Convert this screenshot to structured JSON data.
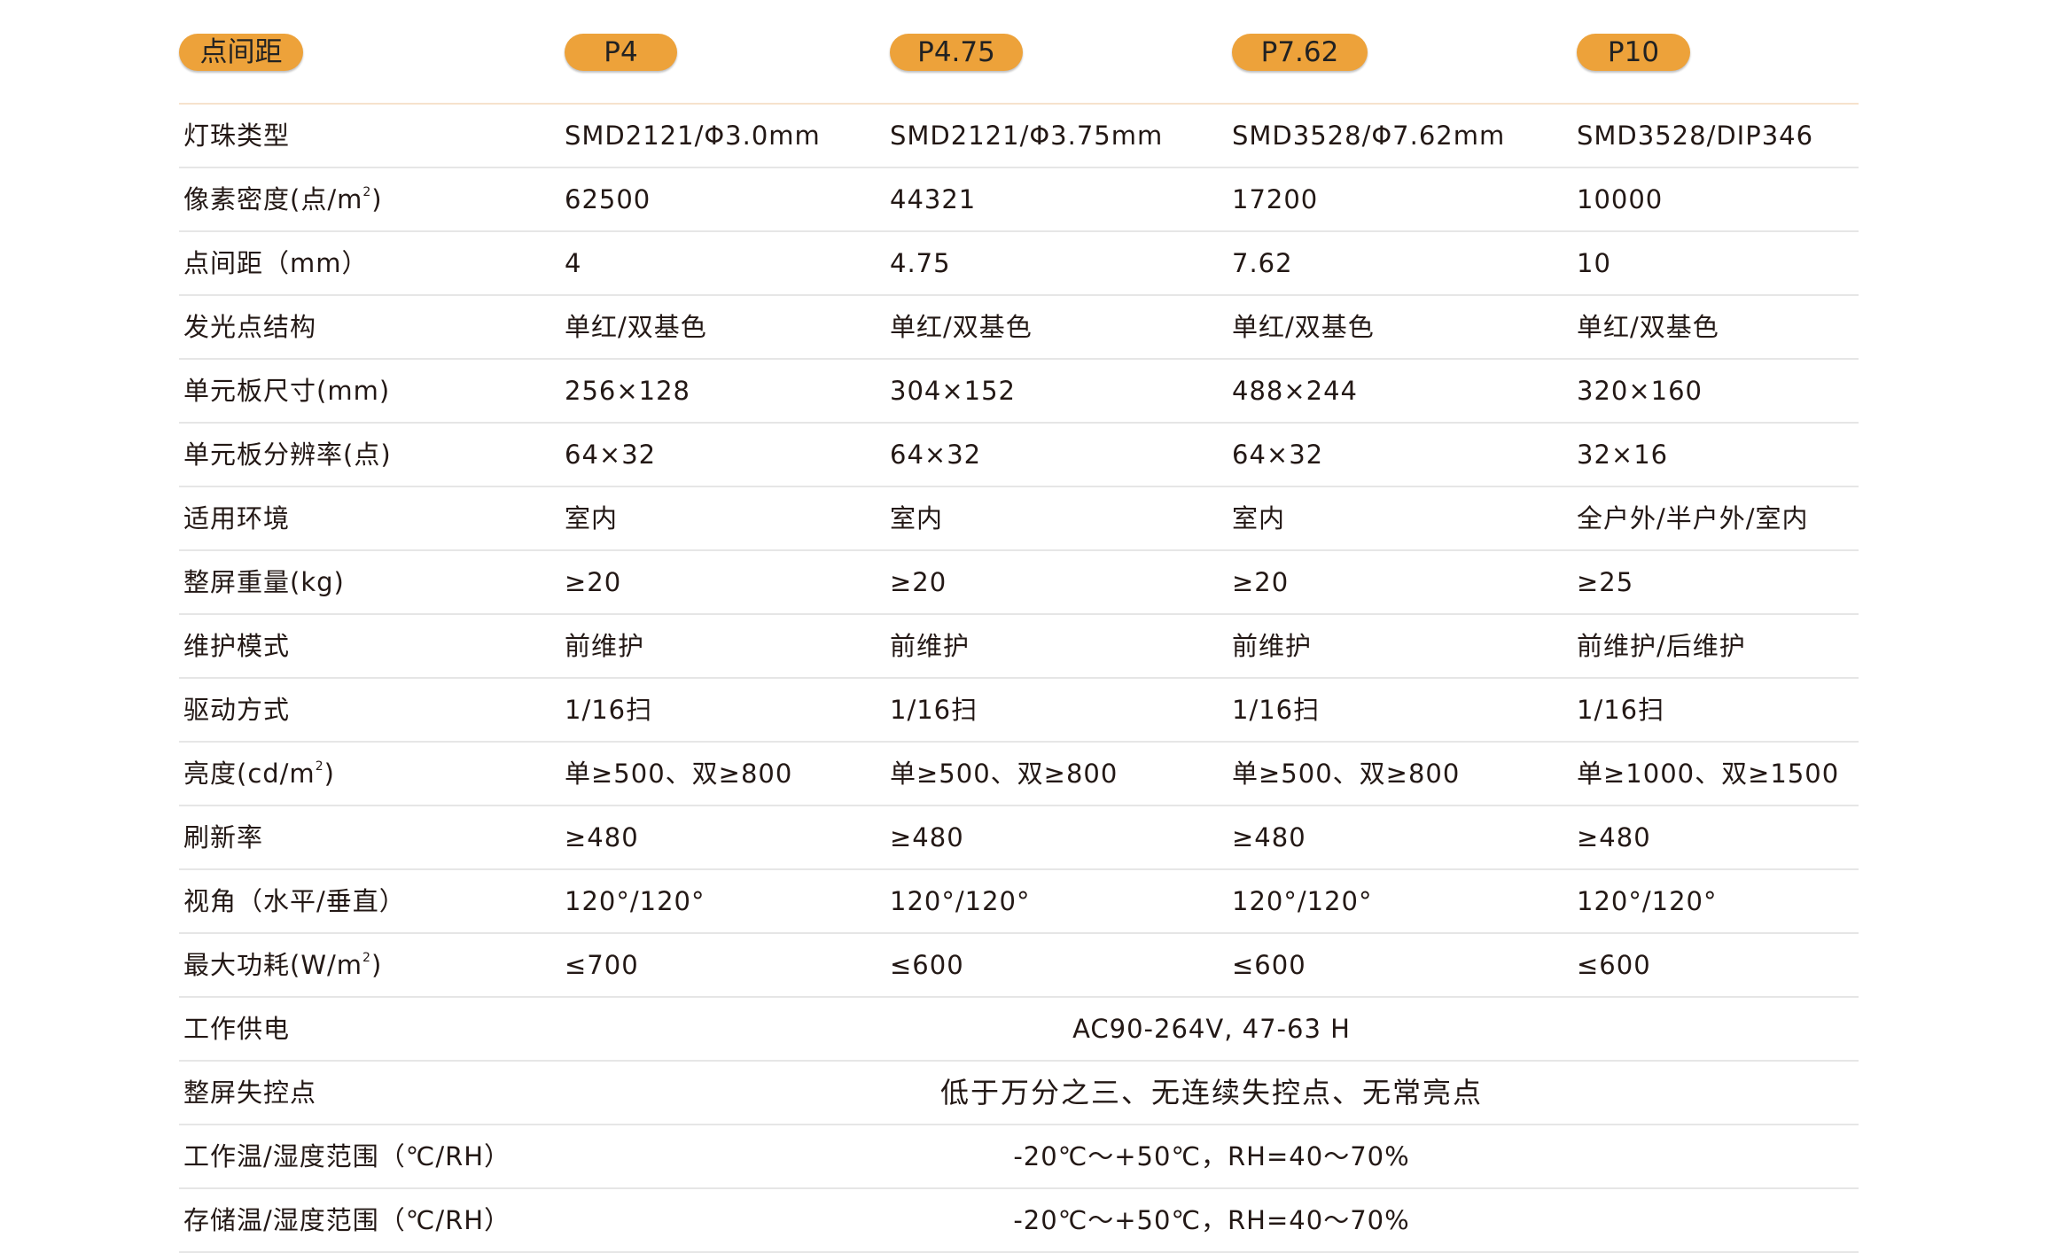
{
  "header": {
    "label": "点间距",
    "columns": [
      "P4",
      "P4.75",
      "P7.62",
      "P10"
    ]
  },
  "rows": [
    {
      "label": "灯珠类型",
      "values": [
        "SMD2121/Φ3.0mm",
        "SMD2121/Φ3.75mm",
        "SMD3528/Φ7.62mm",
        "SMD3528/DIP346"
      ]
    },
    {
      "label_pre": "像素密度(点/m",
      "label_sup": "2",
      "label_post": ")",
      "values": [
        "62500",
        "44321",
        "17200",
        "10000"
      ]
    },
    {
      "label": "点间距（mm）",
      "values": [
        "4",
        "4.75",
        "7.62",
        "10"
      ]
    },
    {
      "label": "发光点结构",
      "values": [
        "单红/双基色",
        "单红/双基色",
        "单红/双基色",
        "单红/双基色"
      ]
    },
    {
      "label": "单元板尺寸(mm)",
      "values": [
        "256×128",
        "304×152",
        "488×244",
        "320×160"
      ]
    },
    {
      "label": "单元板分辨率(点)",
      "values": [
        "64×32",
        "64×32",
        "64×32",
        "32×16"
      ]
    },
    {
      "label": "适用环境",
      "values": [
        "室内",
        "室内",
        "室内",
        "全户外/半户外/室内"
      ]
    },
    {
      "label": "整屏重量(kg)",
      "values": [
        "≥20",
        "≥20",
        "≥20",
        "≥25"
      ]
    },
    {
      "label": "维护模式",
      "values": [
        "前维护",
        "前维护",
        "前维护",
        "前维护/后维护"
      ]
    },
    {
      "label": "驱动方式",
      "values": [
        "1/16扫",
        "1/16扫",
        "1/16扫",
        "1/16扫"
      ]
    },
    {
      "label_pre": "亮度(cd/m",
      "label_sup": "2",
      "label_post": ")",
      "values": [
        "单≥500、双≥800",
        "单≥500、双≥800",
        "单≥500、双≥800",
        "单≥1000、双≥1500"
      ]
    },
    {
      "label": "刷新率",
      "values": [
        "≥480",
        "≥480",
        "≥480",
        "≥480"
      ]
    },
    {
      "label": "视角（水平/垂直）",
      "values": [
        "120°/120°",
        "120°/120°",
        "120°/120°",
        "120°/120°"
      ]
    },
    {
      "label_pre": "最大功耗(W/m",
      "label_sup": "2",
      "label_post": ")",
      "values": [
        "≤700",
        "≤600",
        "≤600",
        "≤600"
      ]
    },
    {
      "label": "工作供电",
      "span": "AC90-264V, 47-63 H"
    },
    {
      "label": "整屏失控点",
      "span": "低于万分之三、无连续失控点、无常亮点"
    },
    {
      "label": "工作温/湿度范围（℃/RH）",
      "span": "-20℃～+50℃，RH=40～70%"
    },
    {
      "label": "存储温/湿度范围（℃/RH）",
      "span": "-20℃～+50℃，RH=40～70%"
    }
  ],
  "colors": {
    "pill": "#eda23a",
    "rule": "#e6e6e6",
    "header_rule": "#f6e2cc"
  }
}
